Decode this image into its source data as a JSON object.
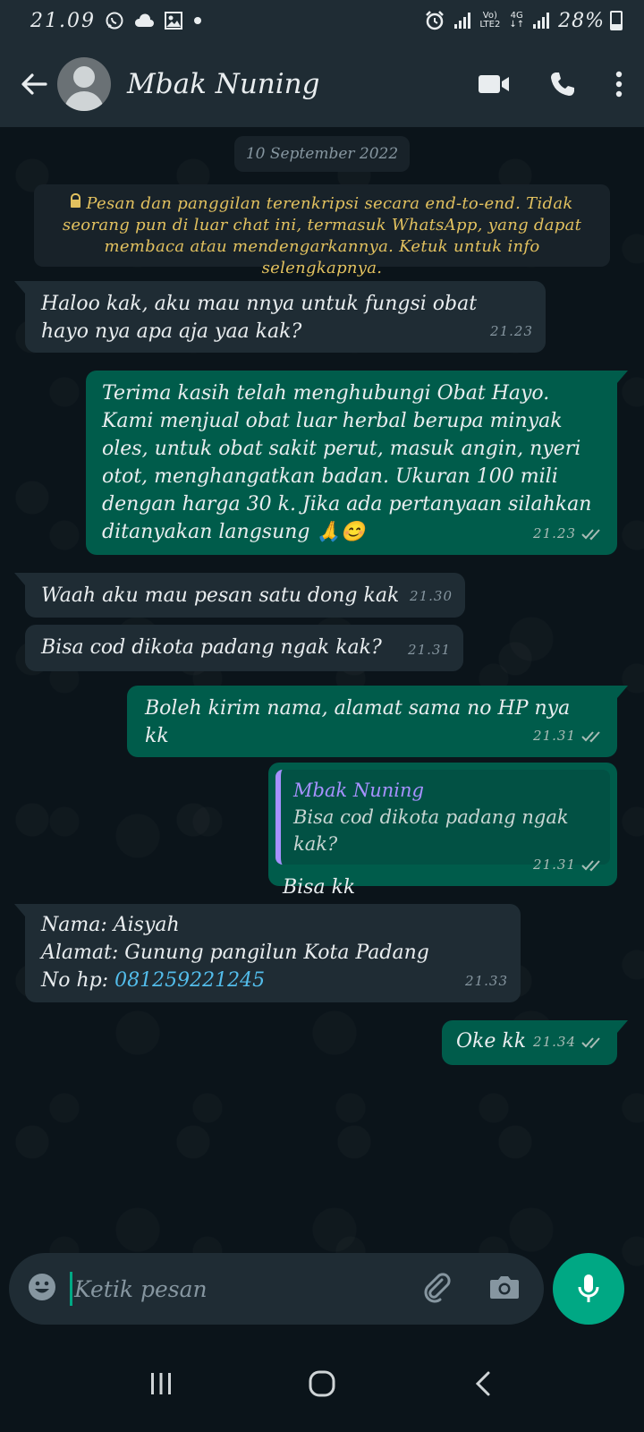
{
  "status_bar": {
    "time": "21.09",
    "network_label_top": "Vo)",
    "network_label_bottom": "LTE2",
    "network_type": "4G",
    "battery": "28%",
    "icons": [
      "whatsapp-icon",
      "cloud-icon",
      "gallery-icon",
      "dot-icon",
      "alarm-icon",
      "signal-icon",
      "signal-icon",
      "battery-icon"
    ]
  },
  "header": {
    "contact_name": "Mbak Nuning",
    "icons": [
      "back-arrow-icon",
      "avatar",
      "video-call-icon",
      "phone-icon",
      "more-options-icon"
    ]
  },
  "chat": {
    "date": "10 September 2022",
    "system_notice": "Pesan dan panggilan terenkripsi secara end-to-end. Tidak seorang pun di luar chat ini, termasuk WhatsApp, yang dapat membaca atau mendengarkannya. Ketuk untuk info selengkapnya.",
    "messages": [
      {
        "direction": "incoming",
        "text": "Haloo kak, aku mau nnya untuk fungsi obat hayo nya apa aja yaa kak?",
        "time": "21.23"
      },
      {
        "direction": "outgoing",
        "text": "Terima kasih telah menghubungi Obat Hayo. Kami menjual obat luar herbal berupa minyak oles, untuk obat sakit perut, masuk angin, nyeri otot, menghangatkan badan. Ukuran 100 mili dengan harga 30 k. Jika ada pertanyaan silahkan ditanyakan langsung 🙏😊",
        "time": "21.23",
        "status": "read"
      },
      {
        "direction": "incoming",
        "text": "Waah aku mau pesan satu dong kak",
        "time": "21.30"
      },
      {
        "direction": "incoming",
        "text": "Bisa cod dikota padang ngak kak?",
        "time": "21.31"
      },
      {
        "direction": "outgoing",
        "text": "Boleh kirim nama, alamat sama no HP nya kk",
        "time": "21.31",
        "status": "read"
      },
      {
        "direction": "outgoing",
        "quote_name": "Mbak Nuning",
        "quote_text": "Bisa cod dikota padang ngak kak?",
        "text": "Bisa kk",
        "time": "21.31",
        "status": "read"
      },
      {
        "direction": "incoming",
        "line1": "Nama: Aisyah",
        "line2": "Alamat: Gunung pangilun Kota Padang",
        "line3_label": "No hp: ",
        "line3_phone": "081259221245",
        "time": "21.33"
      },
      {
        "direction": "outgoing",
        "text": "Oke kk",
        "time": "21.34",
        "status": "read"
      }
    ]
  },
  "composer": {
    "placeholder": "Ketik pesan",
    "icons": [
      "emoji-icon",
      "attachment-icon",
      "camera-icon",
      "microphone-icon"
    ]
  },
  "navigation_bar": {
    "icons": [
      "recent-apps-icon",
      "home-icon",
      "back-nav-icon"
    ]
  },
  "colors": {
    "background": "#0b141a",
    "header": "#1f2c34",
    "incoming_bubble": "#1f2c34",
    "outgoing_bubble": "#005c4b",
    "accent": "#00a884",
    "system_text": "#e2c15f",
    "link": "#53bdeb",
    "quote_name": "#a791ff"
  }
}
